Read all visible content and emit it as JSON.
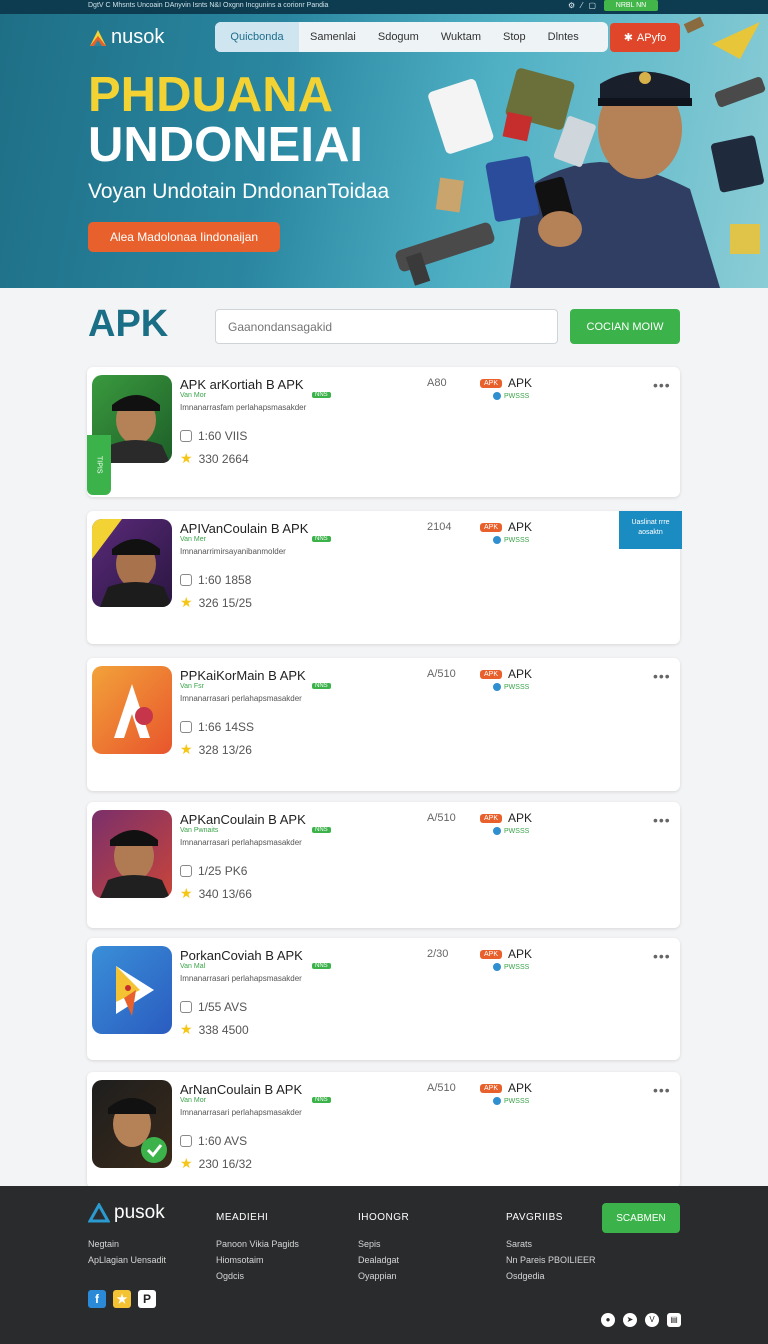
{
  "topbar": {
    "text": "DgtV C Mhsnts Uncoain DAnyvin Isnts N&I Oxgnn Incgunins a corionr Pandia",
    "button_label": "NRBL NN"
  },
  "hero": {
    "logo_text": "nusok",
    "nav_items": [
      "Quicbonda",
      "Samenlai",
      "Sdogum",
      "Wuktam",
      "Stop",
      "Dlntes"
    ],
    "nav_cta_label": "APyfo",
    "title_line1": "PHDUANA",
    "title_line2": "UNDONEIAI",
    "subtitle": "Voyan Undotain DndonanToidaa",
    "cta_label": "Alea Madolonaa Iindonaijan"
  },
  "search": {
    "brand": "APK",
    "placeholder": "Gaanondansagakid",
    "button_label": "COCIAN MOIW"
  },
  "apps": [
    {
      "title": "APK arKortiah B APK",
      "dev": "Van Mor",
      "tag": "NNS",
      "desc": "Imnanarrasfam perlahapsmasakder",
      "stat1": "1:60  VIIS",
      "stat2": "330  2664",
      "version": "A80",
      "apk": "APK",
      "apk_pill": "APK",
      "verified": "PWSSS",
      "side_tab": "TIPIS"
    },
    {
      "title": "APIVanCoulain B APK",
      "dev": "Van Mer",
      "tag": "NNS",
      "desc": "Imnanarrimirsayanibanmolder",
      "stat1": "1:60  1858",
      "stat2": "326  15/25",
      "version": "2104",
      "apk": "APK",
      "apk_pill": "APK",
      "verified": "PWSSS",
      "ribbon": "Uaslinat rrre aosaktn"
    },
    {
      "title": "PPKaiKorMain B APK",
      "dev": "Van Fsr",
      "tag": "NNS",
      "desc": "Imnanarrasari perlahapsmasakder",
      "stat1": "1:66  14SS",
      "stat2": "328  13/26",
      "version": "A/510",
      "apk": "APK",
      "apk_pill": "APK",
      "verified": "PWSSS"
    },
    {
      "title": "APKanCoulain B APK",
      "dev": "Van Pwnaits",
      "tag": "NNS",
      "desc": "Imnanarrasari perlahapsmasakder",
      "stat1": "1/25  PK6",
      "stat2": "340  13/66",
      "version": "A/510",
      "apk": "APK",
      "apk_pill": "APK",
      "verified": "PWSSS"
    },
    {
      "title": "PorkanCoviah B APK",
      "dev": "Van Mal",
      "tag": "NNS",
      "desc": "Imnanarrasari perlahapsmasakder",
      "stat1": "1/55  AVS",
      "stat2": "338  4500",
      "version": "2/30",
      "apk": "APK",
      "apk_pill": "APK",
      "verified": "PWSSS"
    },
    {
      "title": "ArNanCoulain B APK",
      "dev": "Van Mor",
      "tag": "NNS",
      "desc": "Imnanarrasari perlahapsmasakder",
      "stat1": "1:60  AVS",
      "stat2": "230  16/32",
      "version": "A/510",
      "apk": "APK",
      "apk_pill": "APK",
      "verified": "PWSSS"
    }
  ],
  "footer": {
    "logo_text": "pusok",
    "col1": {
      "head": "",
      "items": [
        "Negtain",
        "ApLlagian Uensadit"
      ]
    },
    "col2": {
      "head": "MEADIEHI",
      "items": [
        "Panoon Vikia Pagids",
        "Hiomsotaim",
        "Ogdcis"
      ]
    },
    "col3": {
      "head": "IHOONGR",
      "items": [
        "Sepis",
        "Dealadgat",
        "Oyappian"
      ]
    },
    "col4": {
      "head": "PAVGRIIBS",
      "items": [
        "Sarats",
        "Nn Pareis PBOILIEER",
        "Osdgedia"
      ]
    },
    "button_label": "SCABMEN"
  },
  "colors": {
    "primary": "#1a6e86",
    "accent": "#e8612c",
    "green": "#3cb34a",
    "yellow": "#f3d334"
  }
}
